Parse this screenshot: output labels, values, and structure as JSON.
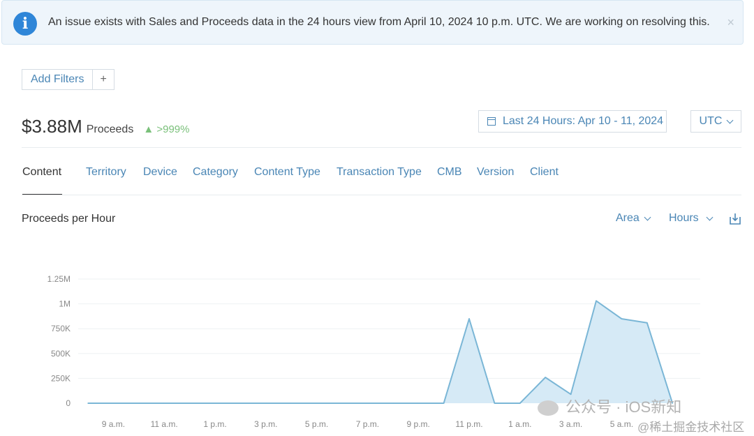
{
  "banner": {
    "message": "An issue exists with Sales and Proceeds data in the 24 hours view from April 10, 2024 10 p.m. UTC. We are working on resolving this.",
    "close_glyph": "×",
    "icon": "info-icon"
  },
  "filters": {
    "add_label": "Add Filters",
    "plus_label": "+"
  },
  "summary": {
    "value": "$3.88M",
    "label": "Proceeds",
    "delta": "▲ >999%",
    "delta_color": "#7ac07a"
  },
  "date_range": {
    "label": "Last 24 Hours: Apr 10 - 11, 2024",
    "icon": "calendar-icon"
  },
  "timezone": {
    "label": "UTC"
  },
  "tabs": [
    {
      "label": "Content",
      "active": true
    },
    {
      "label": "Territory"
    },
    {
      "label": "Device"
    },
    {
      "label": "Category"
    },
    {
      "label": "Content Type"
    },
    {
      "label": "Transaction Type"
    },
    {
      "label": "CMB"
    },
    {
      "label": "Version"
    },
    {
      "label": "Client"
    }
  ],
  "chart_header": {
    "title": "Proceeds per Hour",
    "chart_type_label": "Area",
    "granularity_label": "Hours",
    "download_icon": "download-icon"
  },
  "chart_data": {
    "type": "area",
    "title": "Proceeds per Hour",
    "y_ticks": [
      "0",
      "250K",
      "500K",
      "750K",
      "1M",
      "1.25M"
    ],
    "x_ticks": [
      "9 a.m.",
      "11 a.m.",
      "1 p.m.",
      "3 p.m.",
      "5 p.m.",
      "7 p.m.",
      "9 p.m.",
      "11 p.m.",
      "1 a.m.",
      "3 a.m.",
      "5 a.m."
    ],
    "ylim": [
      0,
      1250000
    ],
    "grid": true,
    "accent_color": "#7ab6d6",
    "fill_color": "#d6eaf6",
    "x": [
      "8 a.m.",
      "9 a.m.",
      "10 a.m.",
      "11 a.m.",
      "12 p.m.",
      "1 p.m.",
      "2 p.m.",
      "3 p.m.",
      "4 p.m.",
      "5 p.m.",
      "6 p.m.",
      "7 p.m.",
      "8 p.m.",
      "9 p.m.",
      "10 p.m.",
      "11 p.m.",
      "12 a.m.",
      "1 a.m.",
      "2 a.m.",
      "3 a.m.",
      "4 a.m.",
      "5 a.m.",
      "6 a.m.",
      "7 a.m."
    ],
    "values": [
      0,
      0,
      0,
      0,
      0,
      0,
      0,
      0,
      0,
      0,
      0,
      0,
      0,
      0,
      0,
      850000,
      0,
      0,
      260000,
      90000,
      1030000,
      850000,
      810000,
      0
    ]
  },
  "watermark": {
    "line1": "公众号 · iOS新知",
    "line2": "@稀土掘金技术社区"
  }
}
